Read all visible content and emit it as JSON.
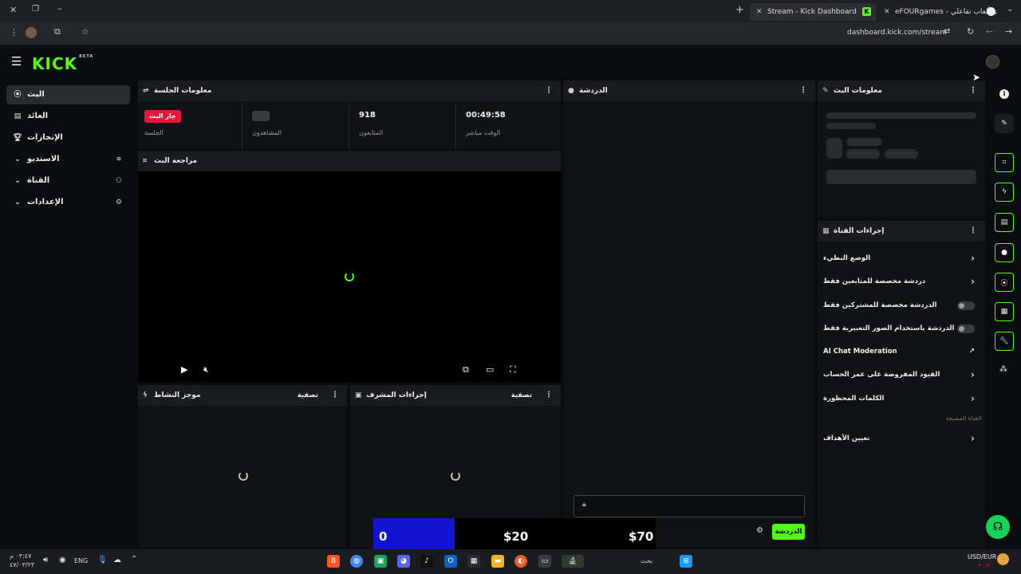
{
  "browser": {
    "tabs": [
      {
        "label": "Stream - Kick Dashboard",
        "active": true
      },
      {
        "label": "eFOURgames - متجر ألعاب تفاعلي",
        "active": false
      }
    ],
    "url": "dashboard.kick.com/stream"
  },
  "app": {
    "logo": "KICK",
    "logo_badge": "BETA",
    "accent": "#53fc18",
    "live_red": "#e5173f"
  },
  "sidebar": {
    "items": [
      {
        "label": "البث",
        "icon": "broadcast-icon",
        "active": true
      },
      {
        "label": "العائد",
        "icon": "money-icon",
        "active": false
      },
      {
        "label": "الإنجازات",
        "icon": "trophy-icon",
        "active": false
      },
      {
        "label": "الاستديو",
        "icon": "studio-icon",
        "active": false
      },
      {
        "label": "القناة",
        "icon": "channel-icon",
        "active": false
      },
      {
        "label": "الإعدادات",
        "icon": "gear-icon",
        "active": false
      }
    ]
  },
  "session": {
    "title": "معلومات الجلسة",
    "live_badge": "جار البث",
    "session_label": "الجلسة",
    "viewers_label": "المشاهدون",
    "followers_value": "918",
    "followers_label": "المتابعون",
    "uptime_value": "00:49:58",
    "uptime_label": "الوقت مباشر"
  },
  "preview": {
    "title": "مراجعة البث"
  },
  "activity": {
    "title": "موجز النشاط",
    "filter": "تصفية"
  },
  "mod": {
    "title": "إجراءات المشرف",
    "filter": "تصفية"
  },
  "chat": {
    "title": "الدردشة",
    "send_label": "الدردشة"
  },
  "stream_info": {
    "title": "معلومات البث"
  },
  "channel_actions": {
    "title": "إجراءات القناة",
    "items": [
      {
        "label": "الوضع البطيء",
        "control": "arrow"
      },
      {
        "label": "دردشة مخصصة للمتابعين فقط",
        "control": "arrow"
      },
      {
        "label": "الدردشة مخصصة للمشتركين فقط",
        "control": "toggle"
      },
      {
        "label": "الدردشة باستخدام الصور التعبيرية فقط",
        "control": "toggle"
      },
      {
        "label": "AI Chat Moderation",
        "control": "external"
      },
      {
        "label": "القيود المفروضة على عمر الحساب",
        "control": "arrow"
      },
      {
        "label": "الكلمات المحظورة",
        "control": "arrow"
      }
    ],
    "section_label": "القناة المضيفة",
    "goals_label": "تعيين الأهداف"
  },
  "overlay": {
    "goal_current": "0",
    "goal_mid": "$20",
    "goal_end": "$70",
    "progress_fraction": 0.0
  },
  "taskbar": {
    "lang": "ENG",
    "search_label": "بحث",
    "currency": "USD/EUR",
    "currency_change": "+٠٫٧٠",
    "time": "٠٣:٤٧ م",
    "date": "٤٧/٠٣/٢٣"
  }
}
